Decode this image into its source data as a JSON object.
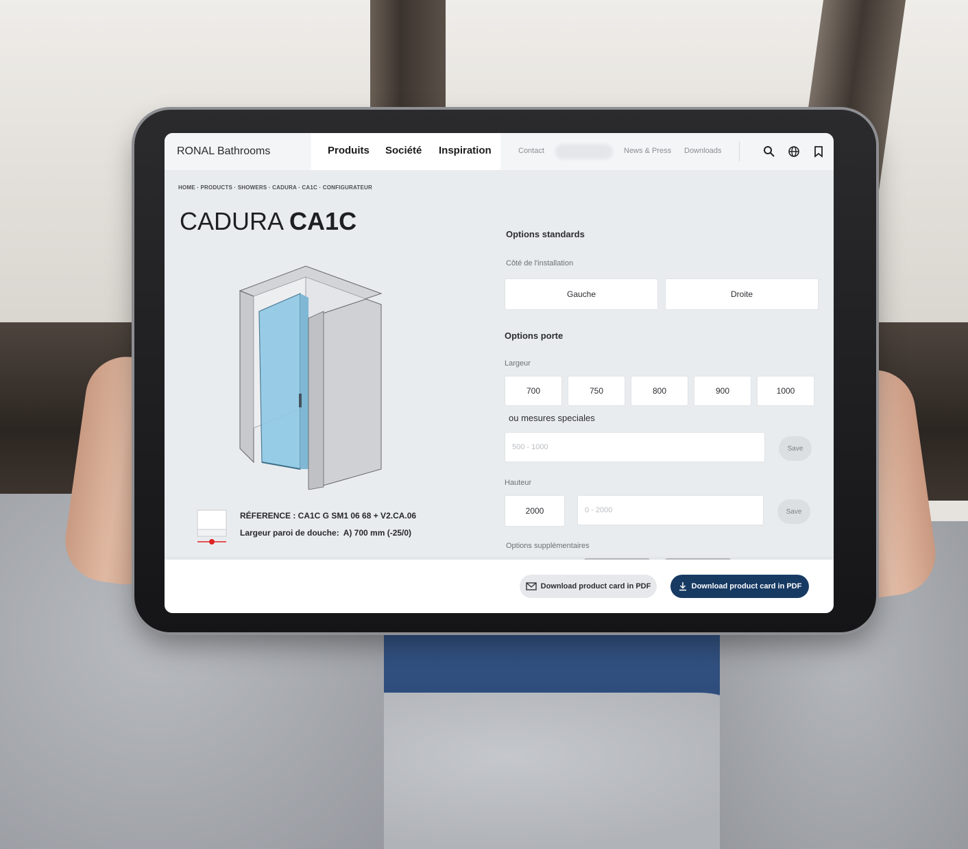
{
  "header": {
    "brand": "RONAL Bathrooms",
    "main_nav": [
      "Produits",
      "Société",
      "Inspiration"
    ],
    "secondary_nav": [
      "Contact",
      "News & Press",
      "Downloads"
    ],
    "icons": [
      "search-icon",
      "globe-icon",
      "bookmark-icon"
    ]
  },
  "breadcrumb": "HOME · PRODUCTS · SHOWERS · CADURA · CA1C · CONFIGURATEUR",
  "product": {
    "title_light": "CADURA",
    "title_bold": "CA1C",
    "reference": "RÉFERENCE : CA1C G SM1 06 68 + V2.CA.06",
    "width_label": "Largeur paroi de douche:",
    "width_value": "A) 700 mm (-25/0)"
  },
  "options": {
    "standard_title": "Options standards",
    "installation_label": "Côté de l'installation",
    "installation_choices": [
      "Gauche",
      "Droite"
    ],
    "door_title": "Options porte",
    "width_label": "Largeur",
    "width_choices": [
      "700",
      "750",
      "800",
      "900",
      "1000"
    ],
    "special_label": "ou mesures speciales",
    "special_placeholder": "500 - 1000",
    "save_label": "Save",
    "height_label": "Hauteur",
    "height_value": "2000",
    "height_placeholder": "0 - 2000",
    "extra_title": "Options supplémentaires"
  },
  "footer": {
    "download_outline": "Download product card in PDF",
    "download_primary": "Download product card in PDF"
  },
  "colors": {
    "primary_button": "#173a63",
    "glass": "#8fc9e6"
  }
}
